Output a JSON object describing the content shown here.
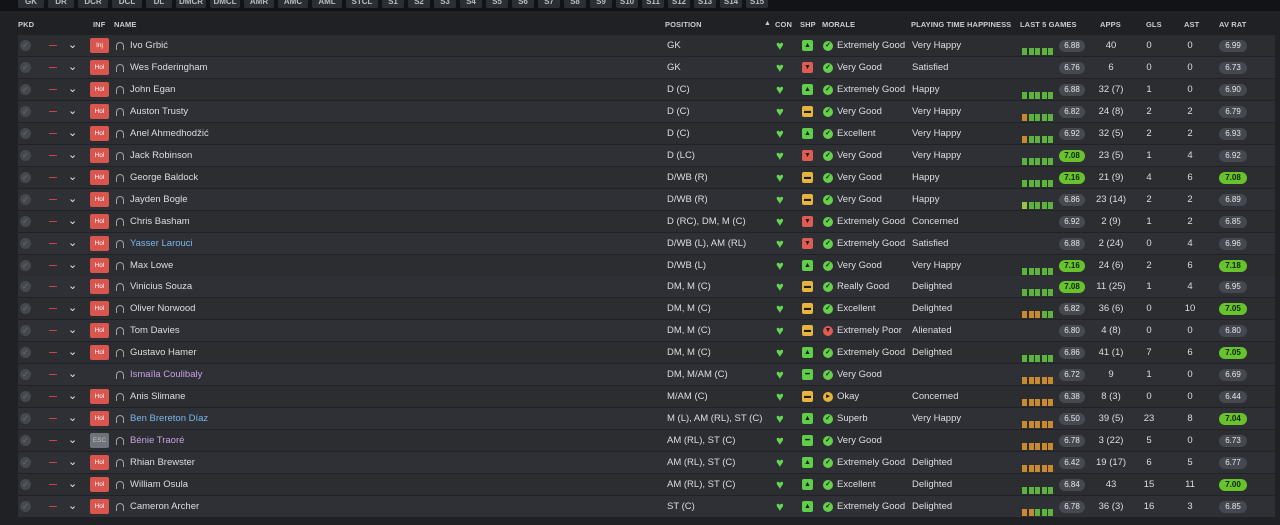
{
  "filter_tabs": [
    "GK",
    "DR",
    "DCR",
    "DCL",
    "DL",
    "DMCR",
    "DMCL",
    "AMR",
    "AMC",
    "AML",
    "STCL",
    "S1",
    "S2",
    "S3",
    "S4",
    "S5",
    "S6",
    "S7",
    "S8",
    "S9",
    "S10",
    "S11",
    "S12",
    "S13",
    "S14",
    "S15"
  ],
  "headers": {
    "pkd": "PKD",
    "inf": "INF",
    "name": "NAME",
    "position": "POSITION",
    "sort_icon": "▲",
    "con": "CON",
    "shp": "SHP",
    "morale": "MORALE",
    "playing_time": "PLAYING TIME HAPPINESS",
    "last5": "LAST 5 GAMES",
    "apps": "APPS",
    "gls": "GLS",
    "ast": "AST",
    "av_rat": "AV RAT"
  },
  "players": [
    {
      "inf": "Inj",
      "inf_style": "red",
      "name": "Ivo Grbić",
      "name_color": "normal",
      "position": "GK",
      "shp": "up",
      "morale_icon": "up",
      "morale": "Extremely Good",
      "happiness": "Very Happy",
      "form": [
        "gr",
        "gr",
        "gr",
        "gr",
        "gr"
      ],
      "last5": "6.88",
      "last5_hi": false,
      "apps": "40",
      "gls": "0",
      "ast": "0",
      "avrat": "6.99",
      "avrat_hi": false
    },
    {
      "inf": "Hol",
      "inf_style": "red",
      "name": "Wes Foderingham",
      "name_color": "normal",
      "position": "GK",
      "shp": "down",
      "morale_icon": "ok",
      "morale": "Very Good",
      "happiness": "Satisfied",
      "form": [],
      "last5": "6.76",
      "last5_hi": false,
      "apps": "6",
      "gls": "0",
      "ast": "0",
      "avrat": "6.73",
      "avrat_hi": false
    },
    {
      "inf": "Hol",
      "inf_style": "red",
      "name": "John Egan",
      "name_color": "normal",
      "position": "D (C)",
      "shp": "up",
      "morale_icon": "up",
      "morale": "Extremely Good",
      "happiness": "Happy",
      "form": [
        "gr",
        "gr",
        "gr",
        "gr",
        "gr"
      ],
      "last5": "6.88",
      "last5_hi": false,
      "apps": "32 (7)",
      "gls": "1",
      "ast": "0",
      "avrat": "6.90",
      "avrat_hi": false
    },
    {
      "inf": "Hol",
      "inf_style": "red",
      "name": "Auston Trusty",
      "name_color": "normal",
      "position": "D (C)",
      "shp": "mid",
      "morale_icon": "ok",
      "morale": "Very Good",
      "happiness": "Very Happy",
      "form": [
        "or",
        "gr",
        "gr",
        "gr",
        "gr"
      ],
      "last5": "6.82",
      "last5_hi": false,
      "apps": "24 (8)",
      "gls": "2",
      "ast": "2",
      "avrat": "6.79",
      "avrat_hi": false
    },
    {
      "inf": "Hol",
      "inf_style": "red",
      "name": "Anel Ahmedhodžić",
      "name_color": "normal",
      "position": "D (C)",
      "shp": "up",
      "morale_icon": "up",
      "morale": "Excellent",
      "happiness": "Very Happy",
      "form": [
        "or",
        "gr",
        "gr",
        "gr",
        "gr"
      ],
      "last5": "6.92",
      "last5_hi": false,
      "apps": "32 (5)",
      "gls": "2",
      "ast": "2",
      "avrat": "6.93",
      "avrat_hi": false
    },
    {
      "inf": "Hol",
      "inf_style": "red",
      "name": "Jack Robinson",
      "name_color": "normal",
      "position": "D (LC)",
      "shp": "down",
      "morale_icon": "ok",
      "morale": "Very Good",
      "happiness": "Very Happy",
      "form": [
        "gr",
        "gr",
        "gr",
        "gr",
        "gr"
      ],
      "last5": "7.08",
      "last5_hi": true,
      "apps": "23 (5)",
      "gls": "1",
      "ast": "4",
      "avrat": "6.92",
      "avrat_hi": false
    },
    {
      "inf": "Hol",
      "inf_style": "red",
      "name": "George Baldock",
      "name_color": "normal",
      "position": "D/WB (R)",
      "shp": "mid",
      "morale_icon": "ok",
      "morale": "Very Good",
      "happiness": "Happy",
      "form": [
        "gr",
        "gr",
        "gr",
        "gr",
        "gr"
      ],
      "last5": "7.16",
      "last5_hi": true,
      "apps": "21 (9)",
      "gls": "4",
      "ast": "6",
      "avrat": "7.08",
      "avrat_hi": true
    },
    {
      "inf": "Hol",
      "inf_style": "red",
      "name": "Jayden Bogle",
      "name_color": "normal",
      "position": "D/WB (R)",
      "shp": "mid",
      "morale_icon": "ok",
      "morale": "Very Good",
      "happiness": "Happy",
      "form": [
        "lg",
        "gr",
        "gr",
        "gr",
        "gr"
      ],
      "last5": "6.86",
      "last5_hi": false,
      "apps": "23 (14)",
      "gls": "2",
      "ast": "2",
      "avrat": "6.89",
      "avrat_hi": false
    },
    {
      "inf": "Hol",
      "inf_style": "red",
      "name": "Chris Basham",
      "name_color": "normal",
      "position": "D (RC), DM, M (C)",
      "shp": "down",
      "morale_icon": "up",
      "morale": "Extremely Good",
      "happiness": "Concerned",
      "form": [],
      "last5": "6.92",
      "last5_hi": false,
      "apps": "2 (9)",
      "gls": "1",
      "ast": "2",
      "avrat": "6.85",
      "avrat_hi": false
    },
    {
      "inf": "Hol",
      "inf_style": "red",
      "name": "Yasser Larouci",
      "name_color": "blue",
      "position": "D/WB (L), AM (RL)",
      "shp": "down",
      "morale_icon": "up",
      "morale": "Extremely Good",
      "happiness": "Satisfied",
      "form": [],
      "last5": "6.88",
      "last5_hi": false,
      "apps": "2 (24)",
      "gls": "0",
      "ast": "4",
      "avrat": "6.96",
      "avrat_hi": false
    },
    {
      "inf": "Hol",
      "inf_style": "red",
      "name": "Max Lowe",
      "name_color": "normal",
      "position": "D/WB (L)",
      "shp": "up",
      "morale_icon": "ok",
      "morale": "Very Good",
      "happiness": "Very Happy",
      "form": [
        "gr",
        "gr",
        "gr",
        "gr",
        "gr"
      ],
      "last5": "7.16",
      "last5_hi": true,
      "apps": "24 (6)",
      "gls": "2",
      "ast": "6",
      "avrat": "7.18",
      "avrat_hi": true
    },
    {
      "inf": "Hol",
      "inf_style": "red",
      "name": "Vinicius Souza",
      "name_color": "normal",
      "position": "DM, M (C)",
      "shp": "mid",
      "morale_icon": "ok",
      "morale": "Really Good",
      "happiness": "Delighted",
      "form": [
        "gr",
        "gr",
        "gr",
        "gr",
        "gr"
      ],
      "last5": "7.08",
      "last5_hi": true,
      "apps": "11 (25)",
      "gls": "1",
      "ast": "4",
      "avrat": "6.95",
      "avrat_hi": false
    },
    {
      "inf": "Hol",
      "inf_style": "red",
      "name": "Oliver Norwood",
      "name_color": "normal",
      "position": "DM, M (C)",
      "shp": "mid",
      "morale_icon": "up",
      "morale": "Excellent",
      "happiness": "Delighted",
      "form": [
        "or",
        "or",
        "or",
        "gr",
        "gr"
      ],
      "last5": "6.82",
      "last5_hi": false,
      "apps": "36 (6)",
      "gls": "0",
      "ast": "10",
      "avrat": "7.05",
      "avrat_hi": true
    },
    {
      "inf": "Hol",
      "inf_style": "red",
      "name": "Tom Davies",
      "name_color": "normal",
      "position": "DM, M (C)",
      "shp": "mid",
      "morale_icon": "down",
      "morale": "Extremely Poor",
      "happiness": "Alienated",
      "form": [],
      "last5": "6.80",
      "last5_hi": false,
      "apps": "4 (8)",
      "gls": "0",
      "ast": "0",
      "avrat": "6.80",
      "avrat_hi": false
    },
    {
      "inf": "Hol",
      "inf_style": "red",
      "name": "Gustavo Hamer",
      "name_color": "normal",
      "position": "DM, M (C)",
      "shp": "up",
      "morale_icon": "up",
      "morale": "Extremely Good",
      "happiness": "Delighted",
      "form": [
        "gr",
        "gr",
        "gr",
        "gr",
        "gr"
      ],
      "last5": "6.86",
      "last5_hi": false,
      "apps": "41 (1)",
      "gls": "7",
      "ast": "6",
      "avrat": "7.05",
      "avrat_hi": true
    },
    {
      "inf": "",
      "inf_style": "none",
      "name": "Ismaïla Coulibaly",
      "name_color": "purple",
      "position": "DM, M/AM (C)",
      "shp": "eq",
      "morale_icon": "ok",
      "morale": "Very Good",
      "happiness": "",
      "form": [
        "or",
        "or",
        "or",
        "or",
        "or"
      ],
      "last5": "6.72",
      "last5_hi": false,
      "apps": "9",
      "gls": "1",
      "ast": "0",
      "avrat": "6.69",
      "avrat_hi": false
    },
    {
      "inf": "Hol",
      "inf_style": "red",
      "name": "Anis Slimane",
      "name_color": "normal",
      "position": "M/AM (C)",
      "shp": "mid",
      "morale_icon": "mid",
      "morale": "Okay",
      "happiness": "Concerned",
      "form": [
        "or",
        "or",
        "or",
        "or",
        "or"
      ],
      "last5": "6.38",
      "last5_hi": false,
      "apps": "8 (3)",
      "gls": "0",
      "ast": "0",
      "avrat": "6.44",
      "avrat_hi": false
    },
    {
      "inf": "Hol",
      "inf_style": "red",
      "name": "Ben Brereton Díaz",
      "name_color": "blue",
      "position": "M (L), AM (RL), ST (C)",
      "shp": "up",
      "morale_icon": "up",
      "morale": "Superb",
      "happiness": "Very Happy",
      "form": [
        "or",
        "or",
        "or",
        "or",
        "or"
      ],
      "last5": "6.50",
      "last5_hi": false,
      "apps": "39 (5)",
      "gls": "23",
      "ast": "8",
      "avrat": "7.04",
      "avrat_hi": true
    },
    {
      "inf": "ESC",
      "inf_style": "esc",
      "name": "Bénie Traoré",
      "name_color": "purple",
      "position": "AM (RL), ST (C)",
      "shp": "eq",
      "morale_icon": "ok",
      "morale": "Very Good",
      "happiness": "",
      "form": [
        "or",
        "or",
        "or",
        "or",
        "or"
      ],
      "last5": "6.78",
      "last5_hi": false,
      "apps": "3 (22)",
      "gls": "5",
      "ast": "0",
      "avrat": "6.73",
      "avrat_hi": false
    },
    {
      "inf": "Hol",
      "inf_style": "red",
      "name": "Rhian Brewster",
      "name_color": "normal",
      "position": "AM (RL), ST (C)",
      "shp": "up",
      "morale_icon": "up",
      "morale": "Extremely Good",
      "happiness": "Delighted",
      "form": [
        "or",
        "or",
        "or",
        "or",
        "or"
      ],
      "last5": "6.42",
      "last5_hi": false,
      "apps": "19 (17)",
      "gls": "6",
      "ast": "5",
      "avrat": "6.77",
      "avrat_hi": false
    },
    {
      "inf": "Hol",
      "inf_style": "red",
      "name": "William Osula",
      "name_color": "normal",
      "position": "AM (RL), ST (C)",
      "shp": "up",
      "morale_icon": "up",
      "morale": "Excellent",
      "happiness": "Delighted",
      "form": [
        "gr",
        "gr",
        "gr",
        "gr",
        "gr"
      ],
      "last5": "6.84",
      "last5_hi": false,
      "apps": "43",
      "gls": "15",
      "ast": "11",
      "avrat": "7.00",
      "avrat_hi": true
    },
    {
      "inf": "Hol",
      "inf_style": "red",
      "name": "Cameron Archer",
      "name_color": "normal",
      "position": "ST (C)",
      "shp": "up",
      "morale_icon": "up",
      "morale": "Extremely Good",
      "happiness": "Delighted",
      "form": [
        "or",
        "or",
        "gr",
        "gr",
        "gr"
      ],
      "last5": "6.78",
      "last5_hi": false,
      "apps": "36 (3)",
      "gls": "16",
      "ast": "3",
      "avrat": "6.85",
      "avrat_hi": false
    }
  ]
}
